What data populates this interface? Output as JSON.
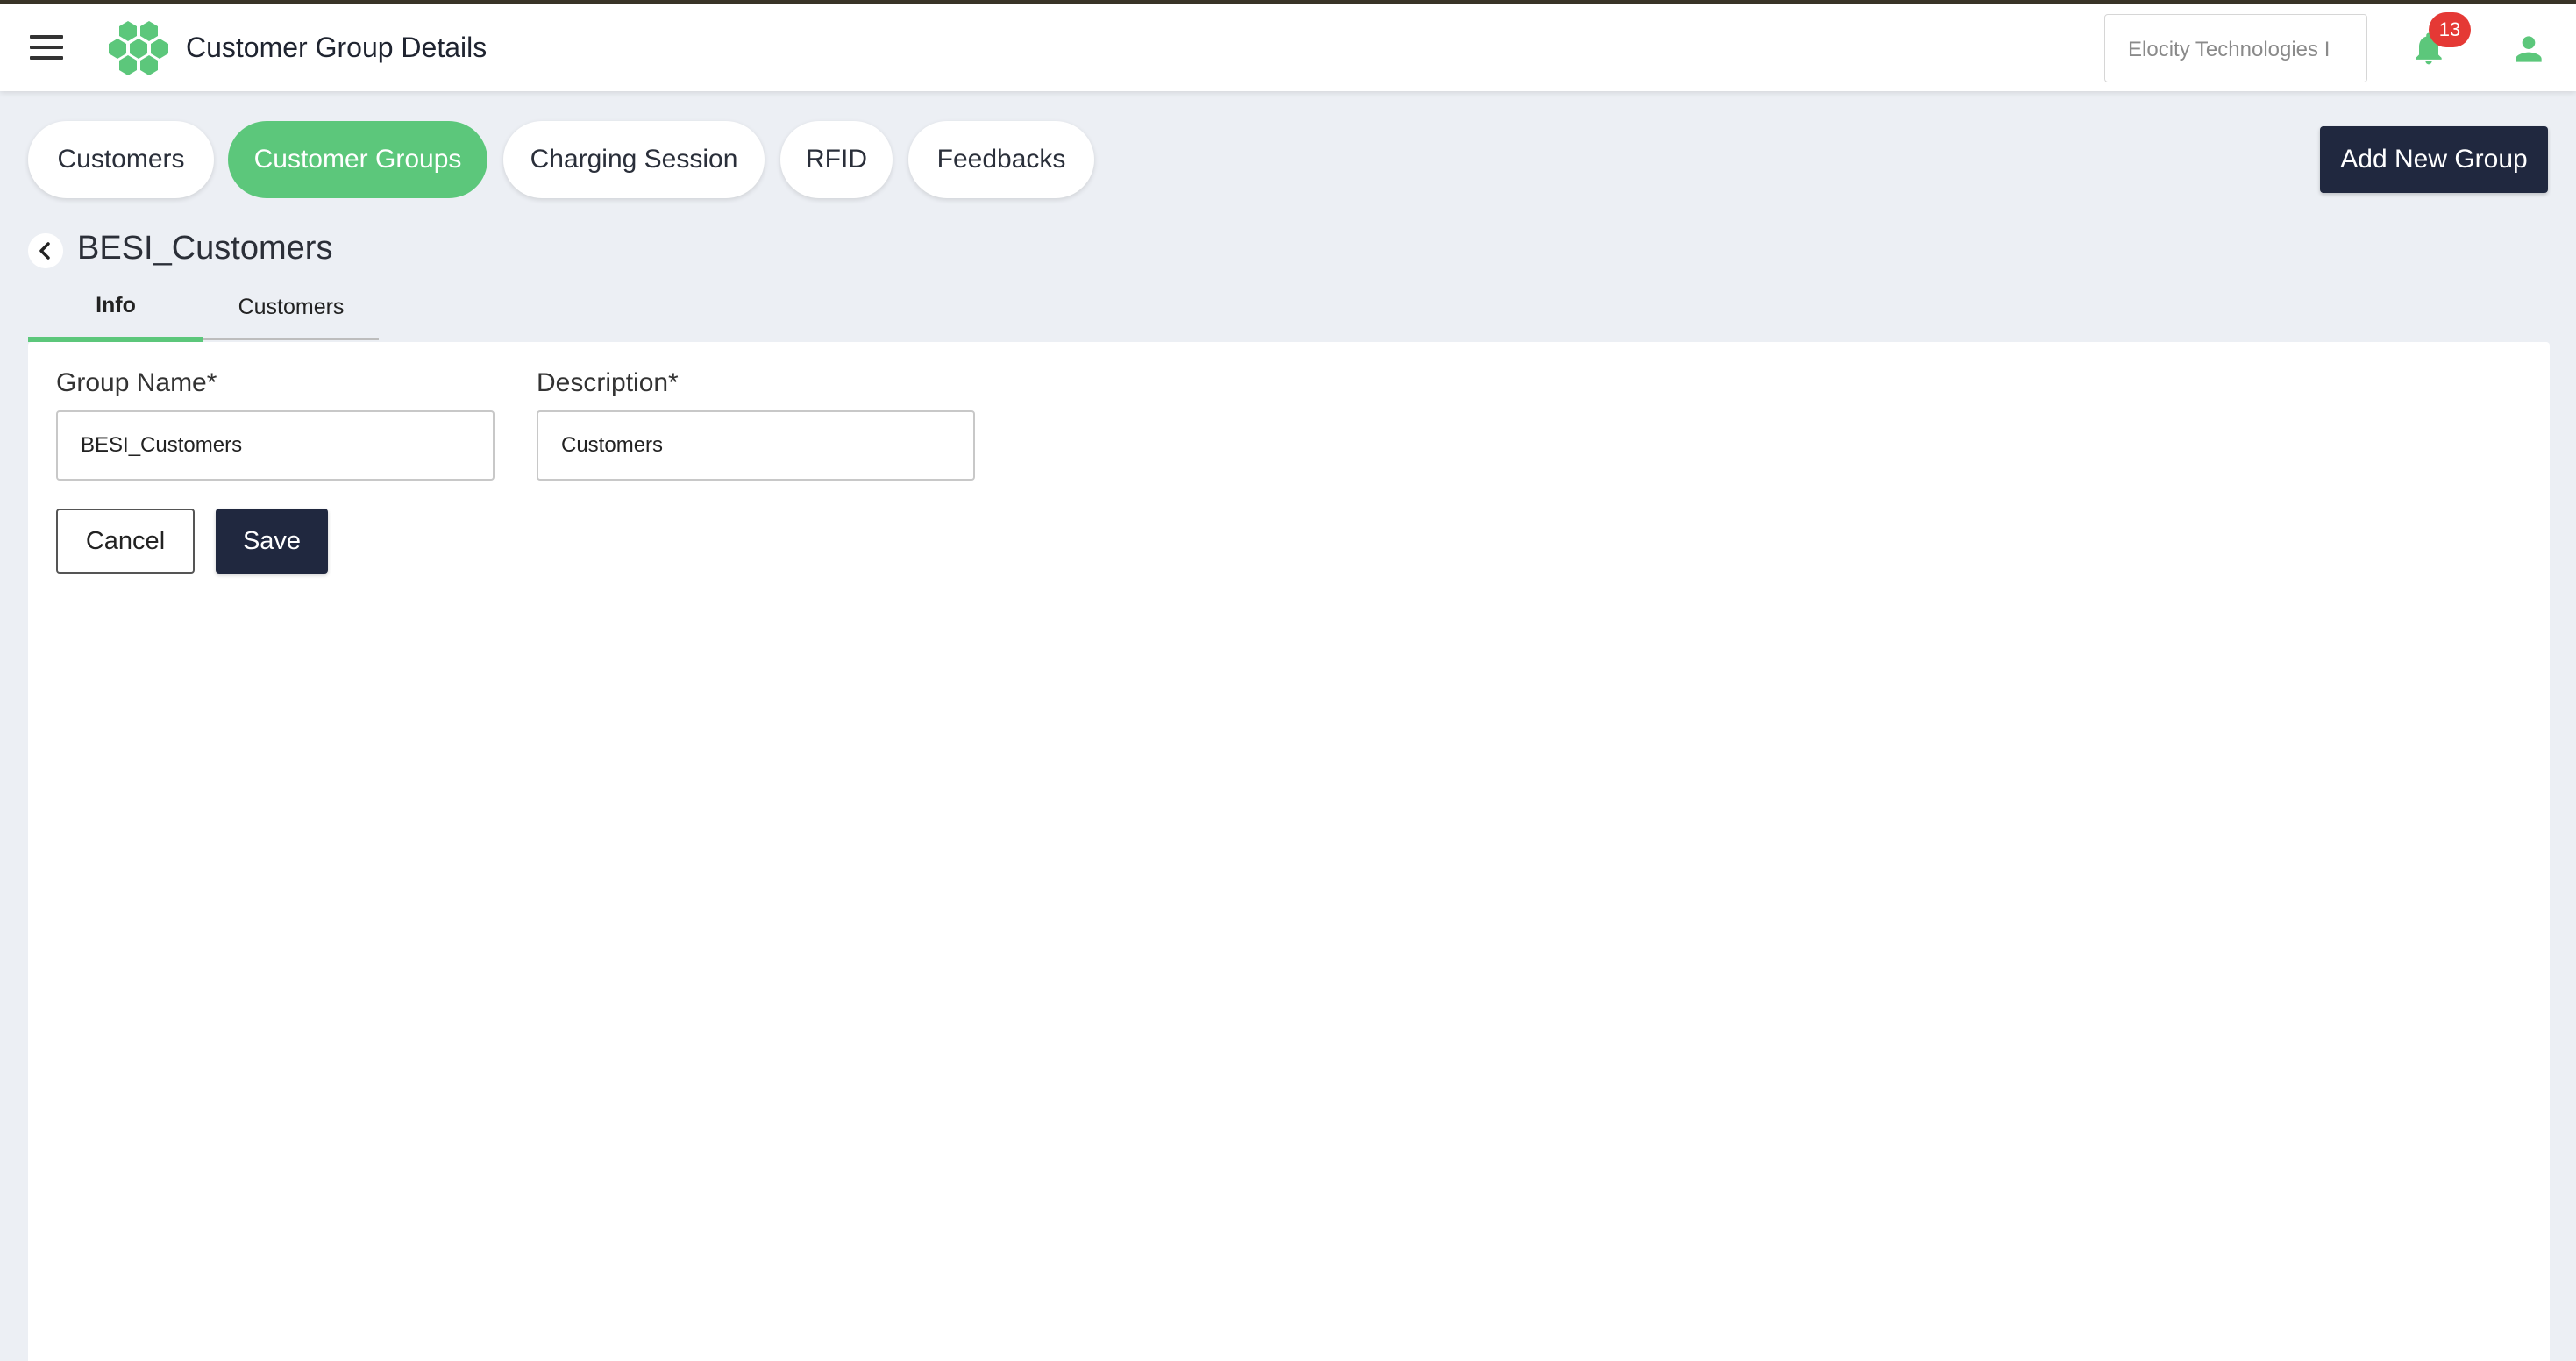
{
  "header": {
    "title": "Customer Group Details",
    "organization": "Elocity Technologies I",
    "notification_count": "13"
  },
  "nav_tabs": [
    {
      "label": "Customers",
      "active": false
    },
    {
      "label": "Customer Groups",
      "active": true
    },
    {
      "label": "Charging Session",
      "active": false
    },
    {
      "label": "RFID",
      "active": false
    },
    {
      "label": "Feedbacks",
      "active": false
    }
  ],
  "actions": {
    "add_new_group_label": "Add New Group"
  },
  "page": {
    "heading": "BESI_Customers"
  },
  "sub_tabs": [
    {
      "label": "Info",
      "active": true
    },
    {
      "label": "Customers",
      "active": false
    }
  ],
  "form": {
    "group_name": {
      "label": "Group Name*",
      "value": "BESI_Customers"
    },
    "description": {
      "label": "Description*",
      "value": "Customers"
    },
    "cancel_label": "Cancel",
    "save_label": "Save"
  },
  "colors": {
    "accent_green": "#5cc77b",
    "primary_navy": "#20283f",
    "badge_red": "#e53935",
    "page_background": "#eceff4"
  },
  "icons": {
    "menu": "hamburger-menu-icon",
    "logo": "hexagon-cluster-logo",
    "notifications": "bell-icon",
    "account": "user-icon",
    "back": "chevron-left-icon"
  }
}
